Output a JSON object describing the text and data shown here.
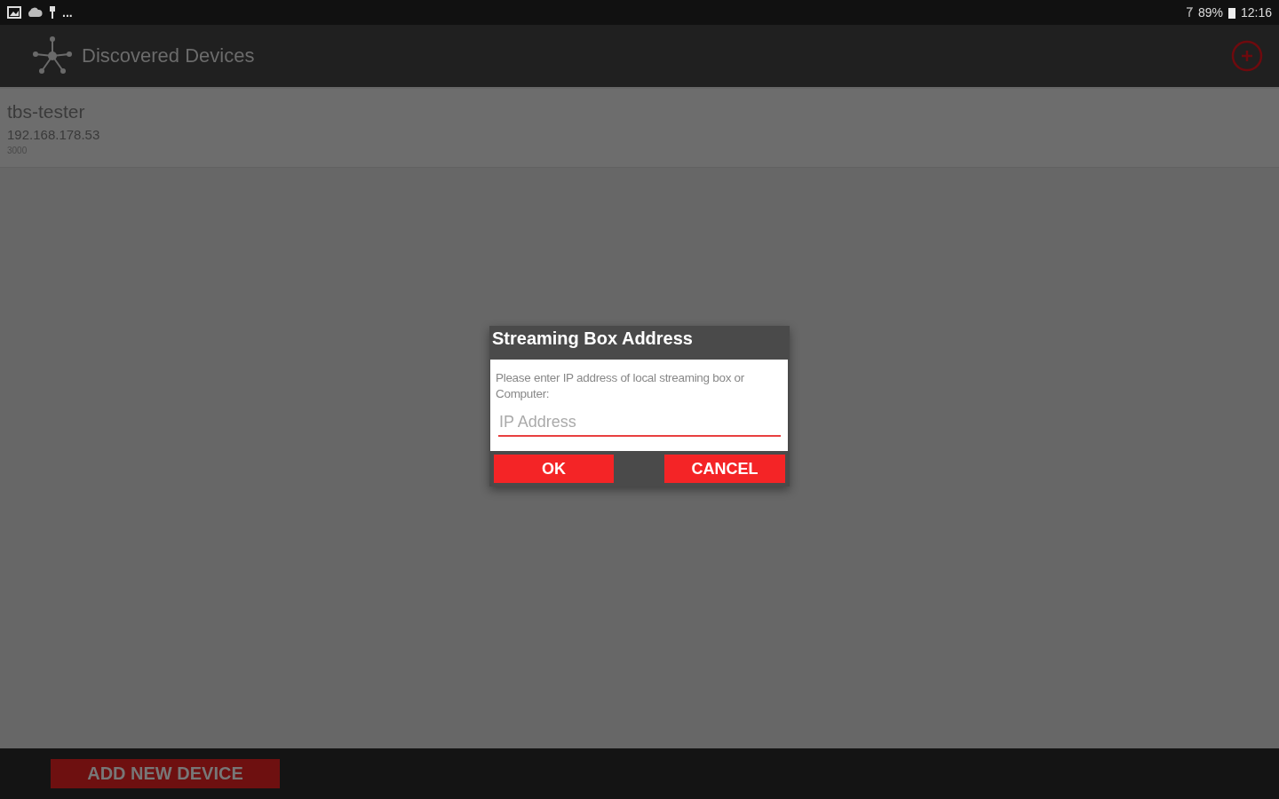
{
  "status_bar": {
    "overflow": "...",
    "battery": "89%",
    "time": "12:16"
  },
  "app_bar": {
    "title": "Discovered Devices"
  },
  "devices": [
    {
      "name": "tbs-tester",
      "address": "192.168.178.53",
      "port": "3000"
    }
  ],
  "dialog": {
    "title": "Streaming Box Address",
    "message": "Please enter IP address of local streaming box or Computer:",
    "field": {
      "placeholder": "IP Address"
    },
    "buttons": [
      "OK",
      "CANCEL"
    ]
  },
  "bottom_bar": {
    "button": "ADD NEW DEVICE"
  }
}
